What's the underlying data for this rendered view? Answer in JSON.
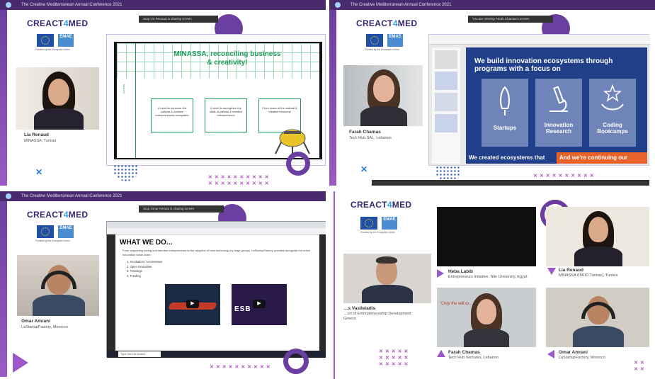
{
  "conference_title": "The Creative Mediterranean Annual Conference 2021",
  "brand": {
    "left": "CREACT",
    "mid": "4",
    "right": "MED"
  },
  "funding_note": "Funded by the European Union",
  "emae_label": "EMAE",
  "q1": {
    "share_bar": "Stop   Lia Renaud is sharing screen",
    "speaker_name": "Lia Renaud",
    "speaker_org": "MINASSA, Tunisia",
    "slide": {
      "title_line1": "MINASSA, reconciling business",
      "title_line2": "& creativity!",
      "boxes": [
        "A need to structure the cultural & creative entrepreneurial ecosystem",
        "A need to strengthen the skills of cultural & creative entrepreneurs",
        "From reach of the cultural & creative economy"
      ]
    }
  },
  "q2": {
    "share_bar": "You are viewing Farah Chamas's screen",
    "speaker_name": "Farah Chamas",
    "speaker_org": "Tech Hub SAL, Lebanon",
    "slide": {
      "headline_line1": "We build innovation ecosystems through",
      "headline_line2": "programs with a focus on",
      "cards": [
        {
          "label_line1": "Startups",
          "label_line2": "",
          "icon": "rocket-icon"
        },
        {
          "label_line1": "Innovation",
          "label_line2": "Research",
          "icon": "microscope-icon"
        },
        {
          "label_line1": "Coding",
          "label_line2": "Bootcamps",
          "icon": "hand-star-icon"
        }
      ],
      "footer_left": "We created ecosystems that",
      "footer_right": "And we're continuing our"
    }
  },
  "q3": {
    "share_bar": "Stop   Omar Amrani is sharing screen",
    "speaker_name": "Omar Amrani",
    "speaker_org": "LaStartupFactory, Morocco",
    "slide": {
      "heading": "WHAT WE DO...",
      "intro": "From supporting young and talented entrepreneurs to the adoption of new technology by large groups, LaStartupFactory provides alongside the entire innovation value chain:",
      "items": [
        "1.   Incubation / Acceleration",
        "2.   Open Innovation",
        "3.   Trainings",
        "4.   Funding"
      ],
      "taskbar_search": "Type here to search"
    }
  },
  "q4": {
    "participants": [
      {
        "name": "Heba Labib",
        "org": "Entrepreneurs Initiative, Nile University, Egypt"
      },
      {
        "name": "Lia Renaud",
        "org": "MINASSA (IMOD Tunisie), Tunisia"
      },
      {
        "name": "…s Vasileiadis",
        "org": "…ort of Entrepreneurship Development\nGreece"
      },
      {
        "name": "Farah Chamas",
        "org": "Tech Hub Ventures, Lebanon"
      },
      {
        "name": "Omar Amrani",
        "org": "LaStartupFactory, Morocco"
      }
    ]
  },
  "colors": {
    "purple_dark": "#3a2670",
    "purple_accent": "#9b59c8",
    "blue_accent": "#2ea0e0",
    "slide_green": "#1e9a5a",
    "slide_blue": "#22408a",
    "orange": "#e8632a"
  }
}
